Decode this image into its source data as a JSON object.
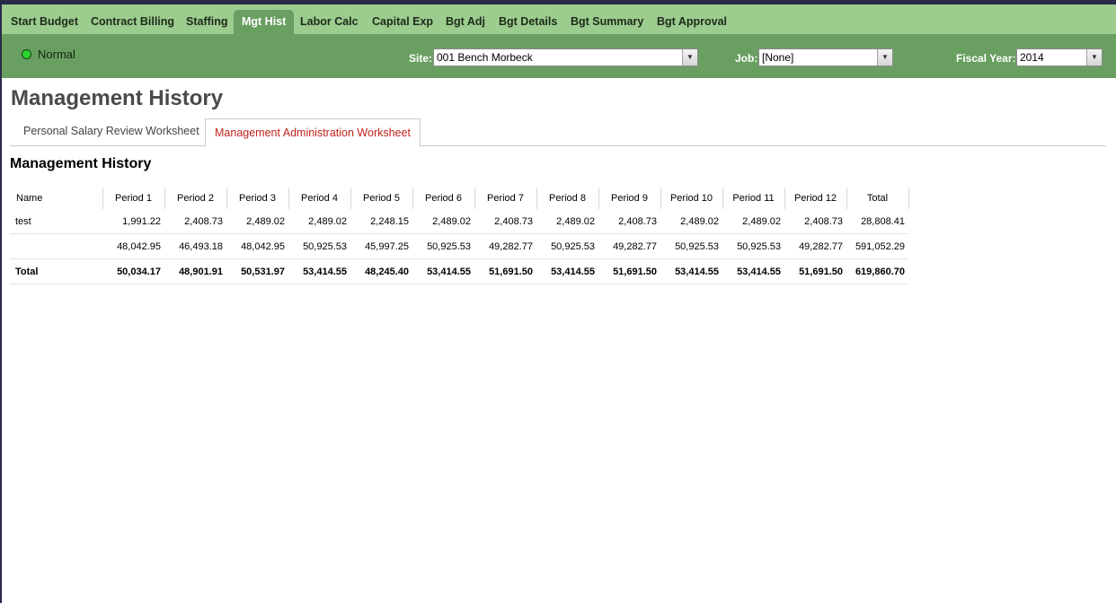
{
  "nav": {
    "items": [
      {
        "label": "Start Budget",
        "active": false
      },
      {
        "label": "Contract Billing",
        "active": false
      },
      {
        "label": "Staffing",
        "active": false
      },
      {
        "label": "Mgt Hist",
        "active": true
      },
      {
        "label": "Labor Calc",
        "active": false
      },
      {
        "label": "Capital Exp",
        "active": false
      },
      {
        "label": "Bgt Adj",
        "active": false
      },
      {
        "label": "Bgt Details",
        "active": false
      },
      {
        "label": "Bgt Summary",
        "active": false
      },
      {
        "label": "Bgt Approval",
        "active": false
      }
    ]
  },
  "toolbar": {
    "status": "Normal",
    "status_color": "#2bd62b",
    "site_label": "Site:",
    "site_value": "001 Bench Morbeck",
    "job_label": "Job:",
    "job_value": "[None]",
    "fy_label": "Fiscal Year:",
    "fy_value": "2014"
  },
  "page": {
    "title": "Management History",
    "tabs": [
      {
        "label": "Personal Salary Review Worksheet",
        "active": false
      },
      {
        "label": "Management Administration Worksheet",
        "active": true
      }
    ],
    "section_title": "Management History"
  },
  "table": {
    "headers": [
      "Name",
      "Period 1",
      "Period 2",
      "Period 3",
      "Period 4",
      "Period 5",
      "Period 6",
      "Period 7",
      "Period 8",
      "Period 9",
      "Period 10",
      "Period 11",
      "Period 12",
      "Total"
    ],
    "rows": [
      [
        "test",
        "1,991.22",
        "2,408.73",
        "2,489.02",
        "2,489.02",
        "2,248.15",
        "2,489.02",
        "2,408.73",
        "2,489.02",
        "2,408.73",
        "2,489.02",
        "2,489.02",
        "2,408.73",
        "28,808.41"
      ],
      [
        "",
        "48,042.95",
        "46,493.18",
        "48,042.95",
        "50,925.53",
        "45,997.25",
        "50,925.53",
        "49,282.77",
        "50,925.53",
        "49,282.77",
        "50,925.53",
        "50,925.53",
        "49,282.77",
        "591,052.29"
      ]
    ],
    "total_row": [
      "Total",
      "50,034.17",
      "48,901.91",
      "50,531.97",
      "53,414.55",
      "48,245.40",
      "53,414.55",
      "51,691.50",
      "53,414.55",
      "51,691.50",
      "53,414.55",
      "53,414.55",
      "51,691.50",
      "619,860.70"
    ]
  },
  "colors": {
    "nav_bg": "#9ccc8e",
    "toolbar_bg": "#6a9f62",
    "active_tab_text": "#c0231b"
  }
}
